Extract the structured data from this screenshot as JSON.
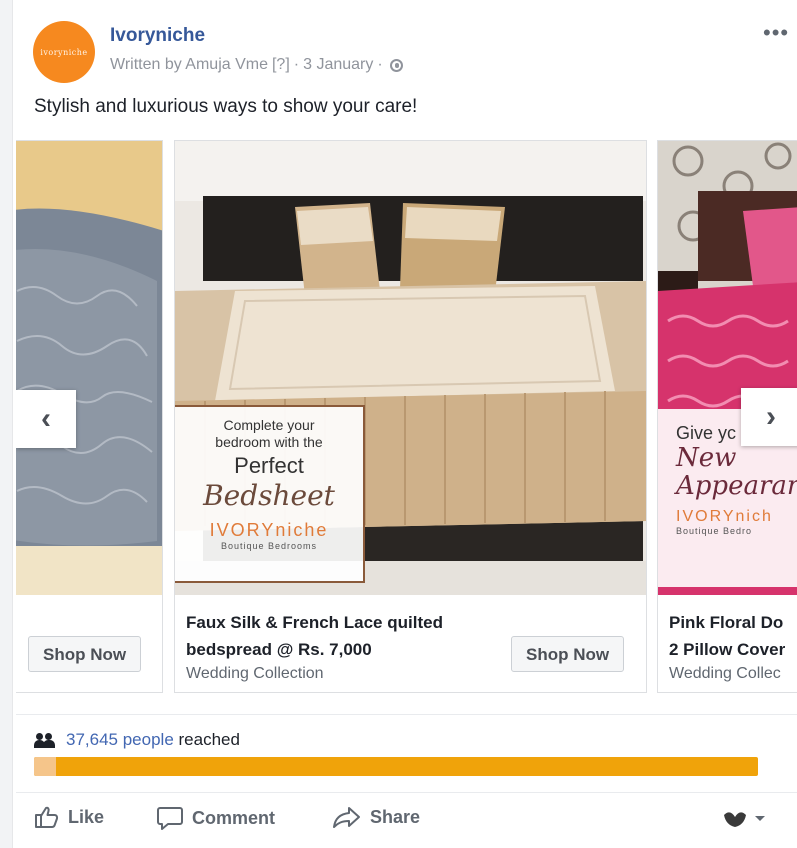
{
  "post": {
    "avatar_text": "ivoryniche",
    "page_name": "Ivoryniche",
    "written_by": "Written by Amuja Vme",
    "help_marker": "[?]",
    "separator": "·",
    "date": "3 January",
    "caption": "Stylish and luxurious ways to show your care!"
  },
  "carousel": {
    "cards": [
      {
        "shop_label": "Shop Now"
      },
      {
        "title": "Faux Silk & French Lace quilted\nbedspread @ Rs. 7,000",
        "subtitle": "Wedding Collection",
        "shop_label": "Shop Now",
        "promo": {
          "line1": "Complete your\nbedroom with the",
          "line2": "Perfect",
          "line3": "Bedsheet",
          "brand": "IVORYniche",
          "brand_sub": "Boutique Bedrooms"
        }
      },
      {
        "title": "Pink Floral Do\n2 Pillow Cover",
        "subtitle": "Wedding Collec",
        "promo": {
          "line1": "Give yc",
          "line2": "New\nAppearan",
          "brand": "IVORYnich",
          "brand_sub": "Boutique Bedro"
        }
      }
    ],
    "prev_arrow": "‹",
    "next_arrow": "›"
  },
  "reach": {
    "count_text": "37,645 people",
    "suffix": "reached",
    "progress_fraction": 0.03
  },
  "actions": {
    "like": "Like",
    "comment": "Comment",
    "share": "Share"
  },
  "colors": {
    "link": "#365899",
    "reach_link": "#4267b2",
    "progress_bar": "#f0a30a",
    "avatar": "#f6891f"
  }
}
